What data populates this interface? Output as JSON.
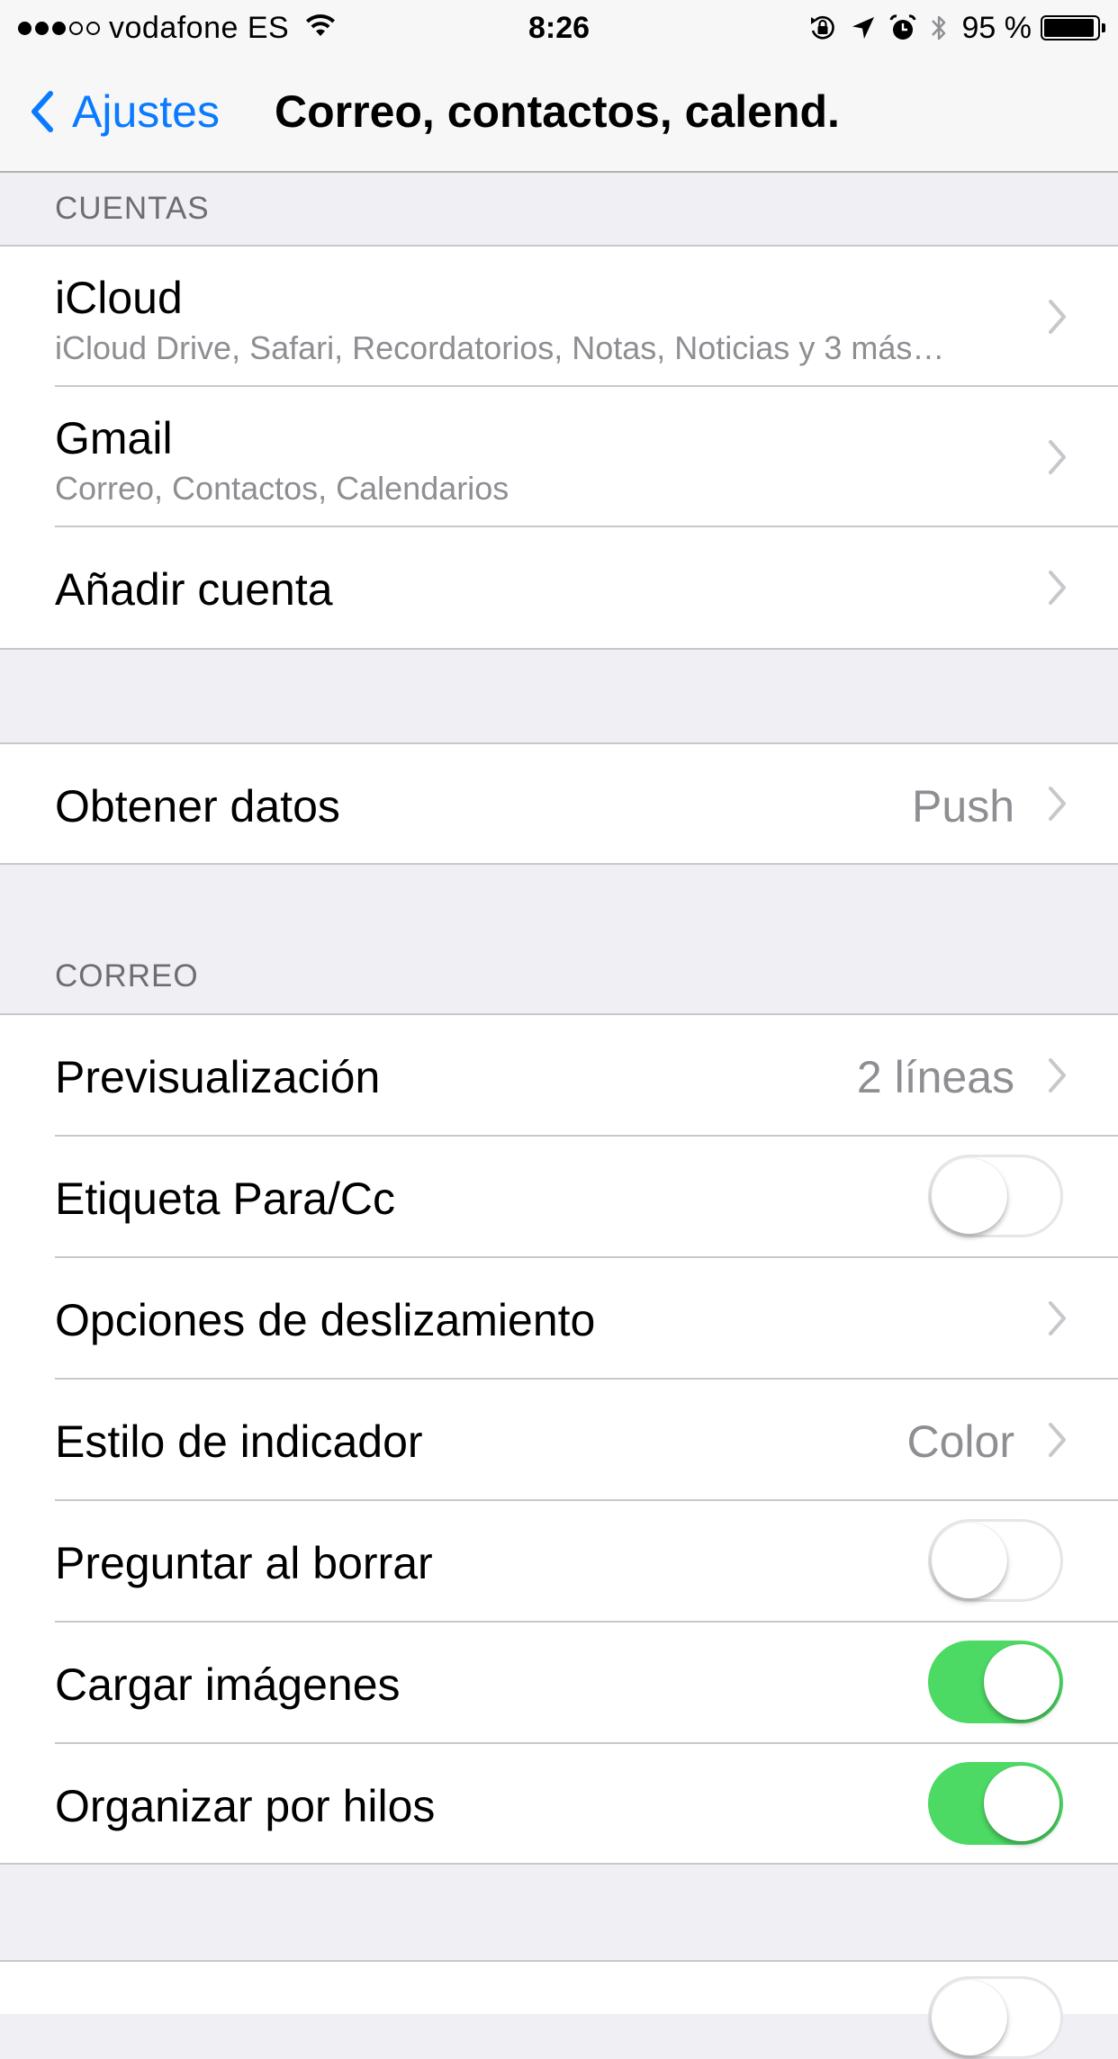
{
  "status_bar": {
    "signal_bars_filled": 3,
    "signal_bars_total": 5,
    "carrier": "vodafone ES",
    "time": "8:26",
    "battery_percent": "95 %",
    "battery_level": 0.95,
    "icons": [
      "wifi-icon",
      "rotation-lock-icon",
      "location-arrow-icon",
      "alarm-icon",
      "bluetooth-icon",
      "battery-icon"
    ]
  },
  "nav": {
    "back_label": "Ajustes",
    "title": "Correo, contactos, calend."
  },
  "accounts": {
    "header": "CUENTAS",
    "items": [
      {
        "title": "iCloud",
        "subtitle": "iCloud Drive, Safari, Recordatorios, Notas, Noticias y 3 más…"
      },
      {
        "title": "Gmail",
        "subtitle": "Correo, Contactos, Calendarios"
      },
      {
        "title": "Añadir cuenta"
      }
    ]
  },
  "fetch": {
    "title": "Obtener datos",
    "value": "Push"
  },
  "mail": {
    "header": "CORREO",
    "items": [
      {
        "title": "Previsualización",
        "value": "2 líneas",
        "type": "disclosure"
      },
      {
        "title": "Etiqueta Para/Cc",
        "type": "toggle",
        "on": false
      },
      {
        "title": "Opciones de deslizamiento",
        "type": "disclosure"
      },
      {
        "title": "Estilo de indicador",
        "value": "Color",
        "type": "disclosure"
      },
      {
        "title": "Preguntar al borrar",
        "type": "toggle",
        "on": false
      },
      {
        "title": "Cargar imágenes",
        "type": "toggle",
        "on": true
      },
      {
        "title": "Organizar por hilos",
        "type": "toggle",
        "on": true
      }
    ]
  },
  "colors": {
    "accent": "#0a7aff",
    "toggle_on": "#4cd964",
    "background": "#efeff4"
  }
}
